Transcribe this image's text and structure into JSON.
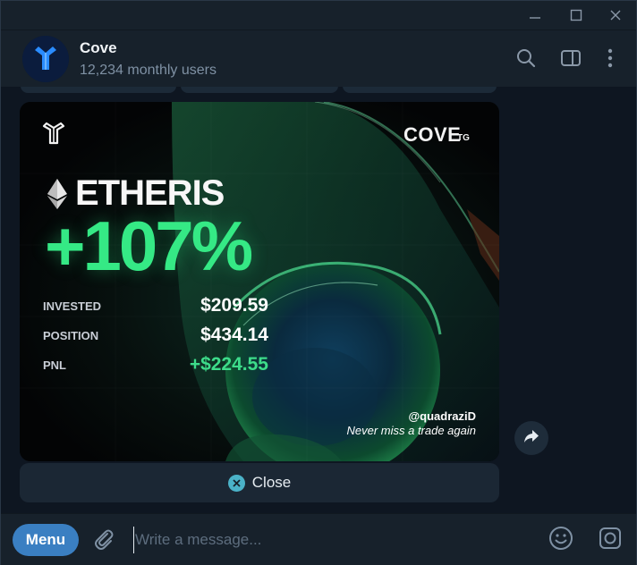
{
  "window": {
    "controls": [
      "minimize-icon",
      "maximize-icon",
      "close-icon"
    ]
  },
  "header": {
    "title": "Cove",
    "subtitle": "12,234 monthly users",
    "icons": [
      "search-icon",
      "sidebar-toggle-icon",
      "more-vertical-icon"
    ]
  },
  "card": {
    "brand": "COVE",
    "brand_suffix": "TG",
    "token_icon": "ethereum-icon",
    "token": "ETHERIS",
    "change": "+107%",
    "stats": [
      {
        "label": "INVESTED",
        "value": "$209.59"
      },
      {
        "label": "POSITION",
        "value": "$434.14"
      },
      {
        "label": "PNL",
        "value": "+$224.55"
      }
    ],
    "handle": "@quadraziD",
    "tagline": "Never miss a trade again",
    "accent": "#35e985"
  },
  "actions": {
    "close_label": "Close",
    "share_icon": "share-arrow-icon"
  },
  "input_bar": {
    "menu_label": "Menu",
    "placeholder": "Write a message...",
    "icons": [
      "paperclip-icon",
      "emoji-icon",
      "camera-icon"
    ]
  },
  "colors": {
    "background": "#0e1621",
    "panel": "#17212b",
    "menu_button": "#3a7fc2",
    "close_icon_bg": "#4bb2c8"
  }
}
